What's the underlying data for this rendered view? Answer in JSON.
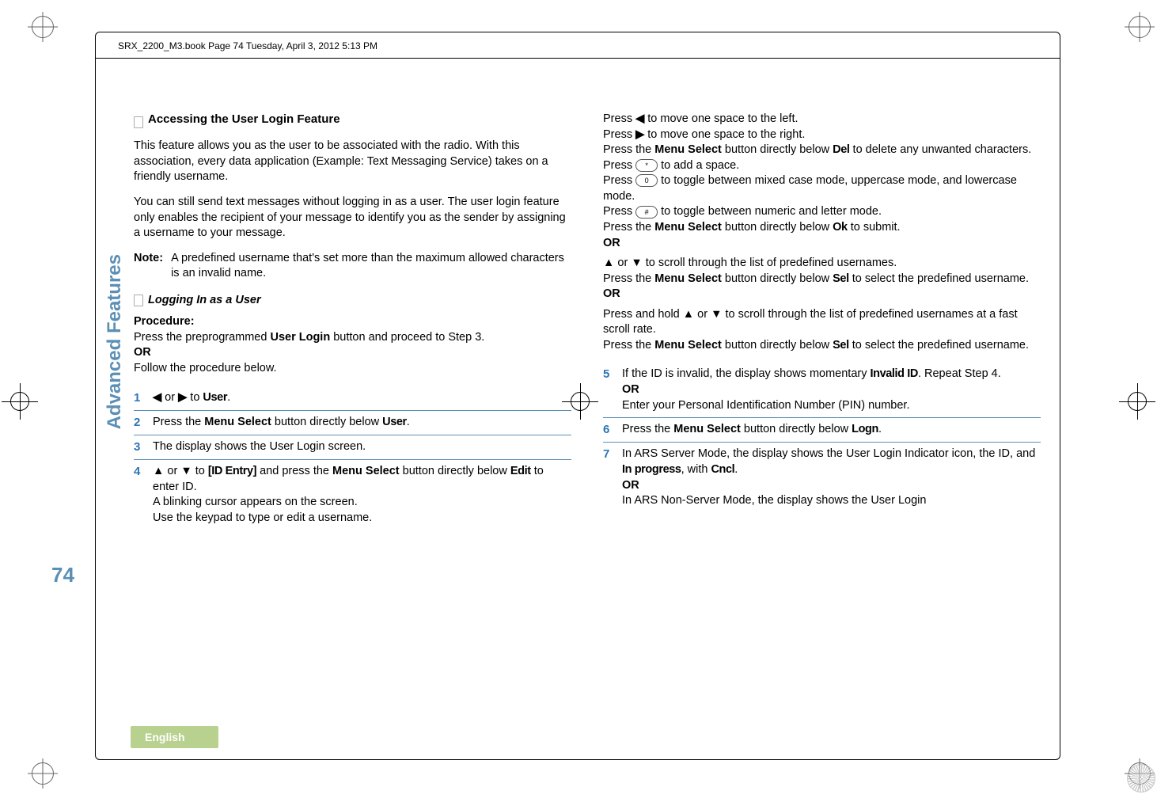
{
  "header": "SRX_2200_M3.book  Page 74  Tuesday, April 3, 2012  5:13 PM",
  "side_label": "Advanced Features",
  "page_number": "74",
  "language_badge": "English",
  "left": {
    "heading1": "Accessing the User Login Feature",
    "para1": "This feature allows you as the user to be associated with the radio. With this association, every data application (Example: Text Messaging Service) takes on a friendly username.",
    "para2": "You can still send text messages without logging in as a user. The user login feature only enables the recipient of your message to identify you as the sender by assigning a username to your message.",
    "note_label": "Note:",
    "note_text": "A predefined username that's set more than the maximum allowed characters is an invalid name.",
    "heading2": "Logging In as a User",
    "proc_label": "Procedure:",
    "proc_intro1a": "Press the preprogrammed ",
    "proc_intro1b": "User Login",
    "proc_intro1c": " button and proceed to Step 3.",
    "or": "OR",
    "proc_intro2": "Follow the procedure below.",
    "step1_num": "1",
    "step1_a": " or ",
    "step1_b": " to ",
    "step1_ui": "User",
    "step1_c": ".",
    "step2_num": "2",
    "step2_a": "Press the ",
    "step2_b": "Menu Select",
    "step2_c": " button directly below ",
    "step2_ui": "User",
    "step2_d": ".",
    "step3_num": "3",
    "step3_text": "The display shows the User Login screen.",
    "step4_num": "4",
    "step4_a": " or ",
    "step4_b": " to ",
    "step4_ui1": "[ID Entry]",
    "step4_c": " and press the ",
    "step4_d": "Menu Select",
    "step4_e": " button directly below ",
    "step4_ui2": "Edit",
    "step4_f": " to enter ID.",
    "step4_line2": "A blinking cursor appears on the screen.",
    "step4_line3": "Use the keypad to type or edit a username."
  },
  "right": {
    "r1a": "Press ",
    "r1b": " to move one space to the left.",
    "r2a": "Press ",
    "r2b": " to move one space to the right.",
    "r3a": "Press the ",
    "r3b": "Menu Select",
    "r3c": " button directly below ",
    "r3ui": "Del",
    "r3d": " to delete any unwanted characters.",
    "r4a": "Press ",
    "key_star": "*",
    "r4b": " to add a space.",
    "r5a": "Press ",
    "key_0": "0",
    "r5b": " to toggle between mixed case mode, uppercase mode, and lowercase mode.",
    "r6a": "Press ",
    "key_hash": "#",
    "r6b": " to toggle between numeric and letter mode.",
    "r7a": "Press the ",
    "r7b": "Menu Select",
    "r7c": " button directly below ",
    "r7ui": "Ok",
    "r7d": " to submit.",
    "or": "OR",
    "r8a": " or ",
    "r8b": " to scroll through the list of predefined usernames.",
    "r9a": "Press the ",
    "r9b": "Menu Select",
    "r9c": " button directly below ",
    "r9ui": "Sel",
    "r9d": " to select the predefined username.",
    "r10a": "Press and hold ",
    "r10b": " or ",
    "r10c": " to scroll through the list of predefined usernames at a fast scroll rate.",
    "r11a": "Press the ",
    "r11b": "Menu Select",
    "r11c": " button directly below ",
    "r11ui": "Sel",
    "r11d": " to select the predefined username.",
    "step5_num": "5",
    "step5_a": "If the ID is invalid, the display shows momentary ",
    "step5_ui": "Invalid ID",
    "step5_b": ". Repeat Step 4.",
    "step5_or": "OR",
    "step5_c": "Enter your Personal Identification Number (PIN) number.",
    "step6_num": "6",
    "step6_a": "Press the ",
    "step6_b": "Menu Select",
    "step6_c": " button directly below ",
    "step6_ui": "Logn",
    "step6_d": ".",
    "step7_num": "7",
    "step7_a": "In ARS Server Mode, the display shows the User Login Indicator icon, the ID, and ",
    "step7_ui1": "In progress",
    "step7_b": ", with ",
    "step7_ui2": "Cncl",
    "step7_c": ".",
    "step7_or": "OR",
    "step7_d": "In ARS Non-Server Mode, the display shows the User Login"
  }
}
